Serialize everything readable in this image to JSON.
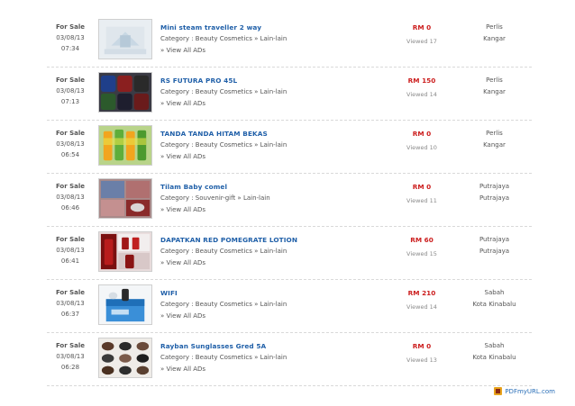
{
  "listings": [
    {
      "type": "For Sale",
      "date": "03/08/13",
      "time": "07:34",
      "title": "Mini steam traveller 2 way",
      "category": "Category : Beauty Cosmetics » Lain-lain",
      "view_all": "» View All ADs",
      "price": "RM 0",
      "views": "Viewed 17",
      "state": "Perlis",
      "city": "Kangar",
      "thumb_icon": "steamer-photo"
    },
    {
      "type": "For Sale",
      "date": "03/08/13",
      "time": "07:13",
      "title": "RS FUTURA PRO 45L",
      "category": "Category : Beauty Cosmetics » Lain-lain",
      "view_all": "» View All ADs",
      "price": "RM 150",
      "views": "Viewed 14",
      "state": "Perlis",
      "city": "Kangar",
      "thumb_icon": "backpacks-photo"
    },
    {
      "type": "For Sale",
      "date": "03/08/13",
      "time": "06:54",
      "title": "TANDA TANDA HITAM BEKAS",
      "category": "Category : Beauty Cosmetics » Lain-lain",
      "view_all": "» View All ADs",
      "price": "RM 0",
      "views": "Viewed 10",
      "state": "Perlis",
      "city": "Kangar",
      "thumb_icon": "bottles-photo"
    },
    {
      "type": "For Sale",
      "date": "03/08/13",
      "time": "06:46",
      "title": "Tilam Baby comel",
      "category": "Category : Souvenir-gift » Lain-lain",
      "view_all": "» View All ADs",
      "price": "RM 0",
      "views": "Viewed 11",
      "state": "Putrajaya",
      "city": "Putrajaya",
      "thumb_icon": "mattress-photo"
    },
    {
      "type": "For Sale",
      "date": "03/08/13",
      "time": "06:41",
      "title": "DAPATKAN RED POMEGRATE LOTION",
      "category": "Category : Beauty Cosmetics » Lain-lain",
      "view_all": "» View All ADs",
      "price": "RM 60",
      "views": "Viewed 15",
      "state": "Putrajaya",
      "city": "Putrajaya",
      "thumb_icon": "lotion-photo"
    },
    {
      "type": "For Sale",
      "date": "03/08/13",
      "time": "06:37",
      "title": "WIFI",
      "category": "Category : Beauty Cosmetics » Lain-lain",
      "view_all": "» View All ADs",
      "price": "RM 210",
      "views": "Viewed 14",
      "state": "Sabah",
      "city": "Kota Kinabalu",
      "thumb_icon": "wifi-box-photo"
    },
    {
      "type": "For Sale",
      "date": "03/08/13",
      "time": "06:28",
      "title": "Rayban Sunglasses Gred 5A",
      "category": "Category : Beauty Cosmetics » Lain-lain",
      "view_all": "» View All ADs",
      "price": "RM 0",
      "views": "Viewed 13",
      "state": "Sabah",
      "city": "Kota Kinabalu",
      "thumb_icon": "sunglasses-photo"
    }
  ],
  "footer": {
    "label": "PDFmyURL.com",
    "icon": "pdf-icon"
  },
  "colors": {
    "title": "#1f5fa8",
    "price": "#cc1e1e",
    "text": "#555555",
    "views": "#8a8a8a"
  }
}
